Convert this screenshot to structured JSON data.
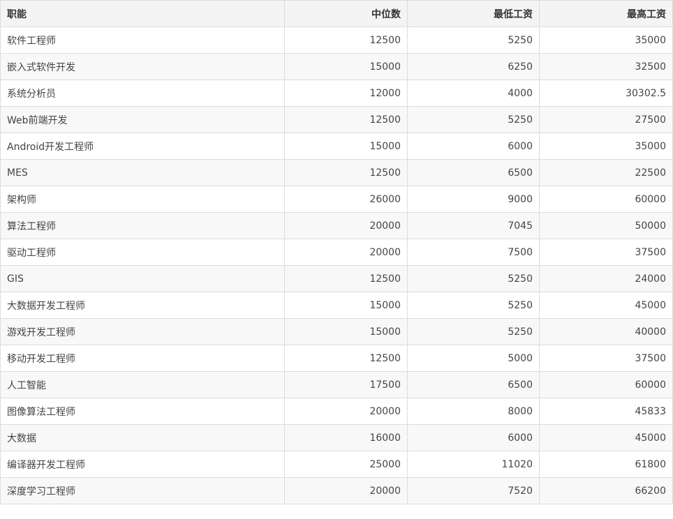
{
  "table": {
    "headers": [
      "职能",
      "中位数",
      "最低工资",
      "最高工资"
    ],
    "rows": [
      [
        "软件工程师",
        "12500",
        "5250",
        "35000"
      ],
      [
        "嵌入式软件开发",
        "15000",
        "6250",
        "32500"
      ],
      [
        "系统分析员",
        "12000",
        "4000",
        "30302.5"
      ],
      [
        "Web前端开发",
        "12500",
        "5250",
        "27500"
      ],
      [
        "Android开发工程师",
        "15000",
        "6000",
        "35000"
      ],
      [
        "MES",
        "12500",
        "6500",
        "22500"
      ],
      [
        "架构师",
        "26000",
        "9000",
        "60000"
      ],
      [
        "算法工程师",
        "20000",
        "7045",
        "50000"
      ],
      [
        "驱动工程师",
        "20000",
        "7500",
        "37500"
      ],
      [
        "GIS",
        "12500",
        "5250",
        "24000"
      ],
      [
        "大数据开发工程师",
        "15000",
        "5250",
        "45000"
      ],
      [
        "游戏开发工程师",
        "15000",
        "5250",
        "40000"
      ],
      [
        "移动开发工程师",
        "12500",
        "5000",
        "37500"
      ],
      [
        "人工智能",
        "17500",
        "6500",
        "60000"
      ],
      [
        "图像算法工程师",
        "20000",
        "8000",
        "45833"
      ],
      [
        "大数据",
        "16000",
        "6000",
        "45000"
      ],
      [
        "编译器开发工程师",
        "25000",
        "11020",
        "61800"
      ],
      [
        "深度学习工程师",
        "20000",
        "7520",
        "66200"
      ]
    ]
  }
}
